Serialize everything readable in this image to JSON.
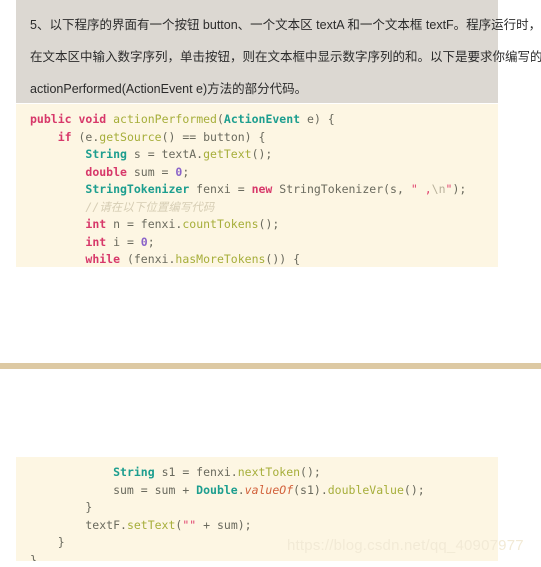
{
  "question": {
    "lines": [
      "5、以下程序的界面有一个按钮 button、一个文本区 textA 和一个文本框 textF。程序运行时，",
      "在文本区中输入数字序列，单击按钮，则在文本框中显示数字序列的和。以下是要求你编写的",
      "actionPerformed(ActionEvent e)方法的部分代码。"
    ]
  },
  "code_top": {
    "lines": [
      {
        "tokens": [
          {
            "t": "public",
            "c": "kw"
          },
          {
            "t": " ",
            "c": "pln"
          },
          {
            "t": "void",
            "c": "kw"
          },
          {
            "t": " ",
            "c": "pln"
          },
          {
            "t": "actionPerformed",
            "c": "fn"
          },
          {
            "t": "(",
            "c": "pln"
          },
          {
            "t": "ActionEvent",
            "c": "typ"
          },
          {
            "t": " e) {",
            "c": "pln"
          }
        ]
      },
      {
        "tokens": [
          {
            "t": "    ",
            "c": "pln"
          },
          {
            "t": "if",
            "c": "kw"
          },
          {
            "t": " (e.",
            "c": "pln"
          },
          {
            "t": "getSource",
            "c": "fn"
          },
          {
            "t": "() == button) {",
            "c": "pln"
          }
        ]
      },
      {
        "tokens": [
          {
            "t": "        ",
            "c": "pln"
          },
          {
            "t": "String",
            "c": "typ"
          },
          {
            "t": " s = textA.",
            "c": "pln"
          },
          {
            "t": "getText",
            "c": "fn"
          },
          {
            "t": "();",
            "c": "pln"
          }
        ]
      },
      {
        "tokens": [
          {
            "t": "        ",
            "c": "pln"
          },
          {
            "t": "double",
            "c": "kw"
          },
          {
            "t": " sum = ",
            "c": "pln"
          },
          {
            "t": "0",
            "c": "num"
          },
          {
            "t": ";",
            "c": "pln"
          }
        ]
      },
      {
        "tokens": [
          {
            "t": "        ",
            "c": "pln"
          },
          {
            "t": "StringTokenizer",
            "c": "typ"
          },
          {
            "t": " fenxi = ",
            "c": "pln"
          },
          {
            "t": "new",
            "c": "kw"
          },
          {
            "t": " StringTokenizer(s, ",
            "c": "pln"
          },
          {
            "t": "\"",
            "c": "strq"
          },
          {
            "t": " ",
            "c": "str"
          },
          {
            "t": ",",
            "c": "strq"
          },
          {
            "t": "\\n",
            "c": "str"
          },
          {
            "t": "\"",
            "c": "strq"
          },
          {
            "t": ");",
            "c": "pln"
          }
        ]
      },
      {
        "tokens": [
          {
            "t": "        ",
            "c": "pln"
          },
          {
            "t": "//请在以下位置编写代码",
            "c": "cmt"
          }
        ]
      },
      {
        "tokens": [
          {
            "t": "        ",
            "c": "pln"
          },
          {
            "t": "int",
            "c": "kw"
          },
          {
            "t": " n = fenxi.",
            "c": "pln"
          },
          {
            "t": "countTokens",
            "c": "fn"
          },
          {
            "t": "();",
            "c": "pln"
          }
        ]
      },
      {
        "tokens": [
          {
            "t": "        ",
            "c": "pln"
          },
          {
            "t": "int",
            "c": "kw"
          },
          {
            "t": " i = ",
            "c": "pln"
          },
          {
            "t": "0",
            "c": "num"
          },
          {
            "t": ";",
            "c": "pln"
          }
        ]
      },
      {
        "tokens": [
          {
            "t": "        ",
            "c": "pln"
          },
          {
            "t": "while",
            "c": "kw"
          },
          {
            "t": " (fenxi.",
            "c": "pln"
          },
          {
            "t": "hasMoreTokens",
            "c": "fn"
          },
          {
            "t": "()) {",
            "c": "pln"
          }
        ]
      }
    ]
  },
  "code_bottom": {
    "lines": [
      {
        "tokens": [
          {
            "t": "            ",
            "c": "pln"
          },
          {
            "t": "String",
            "c": "typ"
          },
          {
            "t": " s1 = fenxi.",
            "c": "pln"
          },
          {
            "t": "nextToken",
            "c": "fn"
          },
          {
            "t": "();",
            "c": "pln"
          }
        ]
      },
      {
        "tokens": [
          {
            "t": "            sum = sum + ",
            "c": "pln"
          },
          {
            "t": "Double",
            "c": "typ"
          },
          {
            "t": ".",
            "c": "pln"
          },
          {
            "t": "valueOf",
            "c": "fn-i"
          },
          {
            "t": "(s1).",
            "c": "pln"
          },
          {
            "t": "doubleValue",
            "c": "fn"
          },
          {
            "t": "();",
            "c": "pln"
          }
        ]
      },
      {
        "tokens": [
          {
            "t": "        }",
            "c": "pln"
          }
        ]
      },
      {
        "tokens": [
          {
            "t": "        textF.",
            "c": "pln"
          },
          {
            "t": "setText",
            "c": "fn"
          },
          {
            "t": "(",
            "c": "pln"
          },
          {
            "t": "\"\"",
            "c": "strq"
          },
          {
            "t": " + sum);",
            "c": "pln"
          }
        ]
      },
      {
        "tokens": [
          {
            "t": "    }",
            "c": "pln"
          }
        ]
      },
      {
        "tokens": [
          {
            "t": "}",
            "c": "pln"
          }
        ]
      }
    ]
  },
  "watermark": {
    "text": "https://blog.csdn.net/qq_40907977"
  },
  "colors": {
    "question_bg": "#dcd8d2",
    "code_bg": "#fdf6e3",
    "separator": "#ddc9a3",
    "keyword": "#d7386a",
    "type": "#1d9e8f",
    "function": "#a6ae3a",
    "number": "#8a63c9",
    "string": "#e0436f",
    "comment": "#d6cdb4",
    "plain": "#6a6a5e",
    "watermark": "#f2ead6"
  }
}
